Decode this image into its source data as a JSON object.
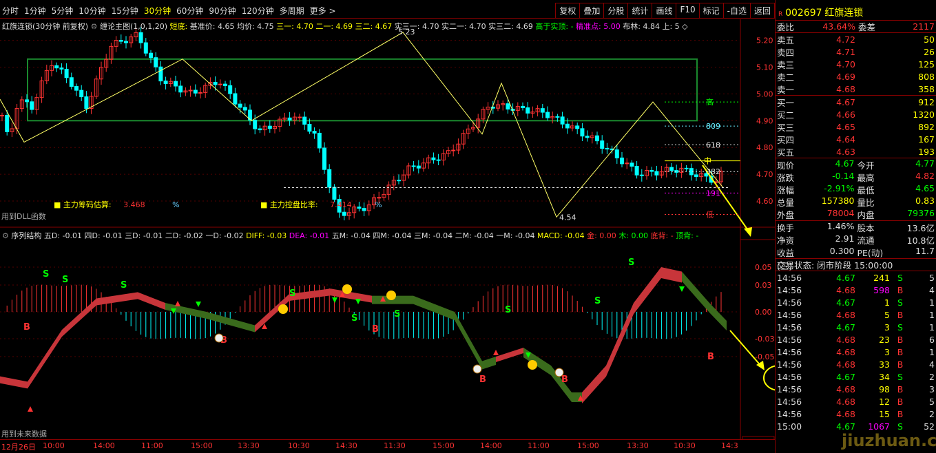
{
  "toolbar": {
    "periods": [
      "分时",
      "1分钟",
      "5分钟",
      "10分钟",
      "15分钟",
      "30分钟",
      "60分钟",
      "90分钟",
      "120分钟",
      "多周期",
      "更多 >"
    ],
    "active_period": "30分钟",
    "tools": [
      "复权",
      "叠加",
      "分股",
      "统计",
      "画线",
      "F10",
      "标记",
      "-自选",
      "返回"
    ]
  },
  "main_info": {
    "title": "红旗连锁(30分钟 前复权)",
    "indicator": "缠论主图(1,0,1,20)",
    "short": "短底:",
    "base": "基准价: 4.65",
    "avg": "均价: 4.75",
    "san1": "三一: 4.70",
    "er1": "二一: 4.69",
    "san2": "三二: 4.67",
    "shi1": "实三一: 4.70",
    "shi2": "实二一: 4.70",
    "shi3": "实三二: 4.69",
    "above": "高于实顶: -",
    "precise": "精准点: 5.00",
    "boll": "布林: 4.84 上: 5 ◇"
  },
  "labels": {
    "dll": "用到DLL函数",
    "future": "用到未来数据",
    "chip": "主力筹码估算:",
    "chip_val": "3.468",
    "pct": "%",
    "ctrl": "主力控盘比率:",
    "ctrl_val": "7.414",
    "high_peak": "5.23",
    "low_peak": "4.54",
    "gao": "高",
    "di": "低",
    "l809": "809",
    "l618": "618",
    "l382": "382",
    "l191": "191",
    "zhong": "中",
    "period_box": "30分钟"
  },
  "sub_info": {
    "title": "序列结构",
    "w5": "五D: -0.01",
    "w4": "四D: -0.01",
    "w3": "三D: -0.01",
    "w2": "二D: -0.02",
    "w1": "一D: -0.02",
    "diff": "DIFF: -0.03",
    "dea": "DEA: -0.01",
    "m5": "五M: -0.04",
    "m4": "四M: -0.04",
    "m3": "三M: -0.04",
    "m2": "二M: -0.04",
    "m1": "一M: -0.04",
    "macd": "MACD: -0.04",
    "jin": "金: 0.00",
    "mu": "木: 0.00",
    "dibei": "底背: -",
    "dingbei": "顶背: -"
  },
  "price_axis": [
    "5.20",
    "5.10",
    "5.00",
    "4.90",
    "4.80",
    "4.70",
    "4.60"
  ],
  "sub_axis": [
    "0.05",
    "0.03",
    "0.00",
    "-0.03",
    "-0.05"
  ],
  "time_axis": [
    "12月26日",
    "10:00",
    "14:00",
    "11:00",
    "15:00",
    "13:30",
    "10:30",
    "14:30",
    "11:30",
    "15:00",
    "14:00",
    "11:00",
    "15:00",
    "13:30",
    "10:30",
    "14:3"
  ],
  "stock": {
    "code": "002697",
    "name": "红旗连锁"
  },
  "order_book": {
    "ratio_label": "委比",
    "ratio": "43.64%",
    "diff_label": "委差",
    "diff": "2117",
    "asks": [
      {
        "l": "卖五",
        "p": "4.72",
        "v": "50"
      },
      {
        "l": "卖四",
        "p": "4.71",
        "v": "26"
      },
      {
        "l": "卖三",
        "p": "4.70",
        "v": "125"
      },
      {
        "l": "卖二",
        "p": "4.69",
        "v": "808"
      },
      {
        "l": "卖一",
        "p": "4.68",
        "v": "358"
      }
    ],
    "bids": [
      {
        "l": "买一",
        "p": "4.67",
        "v": "912"
      },
      {
        "l": "买二",
        "p": "4.66",
        "v": "1320"
      },
      {
        "l": "买三",
        "p": "4.65",
        "v": "892"
      },
      {
        "l": "买四",
        "p": "4.64",
        "v": "167"
      },
      {
        "l": "买五",
        "p": "4.63",
        "v": "193"
      }
    ]
  },
  "stats": [
    [
      {
        "t": "现价",
        "c": "w"
      },
      {
        "t": "4.67",
        "c": "g"
      },
      {
        "t": "今开",
        "c": "w"
      },
      {
        "t": "4.77",
        "c": "g"
      }
    ],
    [
      {
        "t": "涨跌",
        "c": "w"
      },
      {
        "t": "-0.14",
        "c": "g"
      },
      {
        "t": "最高",
        "c": "w"
      },
      {
        "t": "4.82",
        "c": "r"
      }
    ],
    [
      {
        "t": "涨幅",
        "c": "w"
      },
      {
        "t": "-2.91%",
        "c": "g"
      },
      {
        "t": "最低",
        "c": "w"
      },
      {
        "t": "4.65",
        "c": "g"
      }
    ],
    [
      {
        "t": "总量",
        "c": "w"
      },
      {
        "t": "157380",
        "c": "y"
      },
      {
        "t": "量比",
        "c": "w"
      },
      {
        "t": "0.83",
        "c": "y"
      }
    ],
    [
      {
        "t": "外盘",
        "c": "w"
      },
      {
        "t": "78004",
        "c": "r"
      },
      {
        "t": "内盘",
        "c": "w"
      },
      {
        "t": "79376",
        "c": "g"
      }
    ]
  ],
  "stats2": [
    [
      {
        "t": "换手",
        "c": "w"
      },
      {
        "t": "1.46%",
        "c": "w"
      },
      {
        "t": "股本",
        "c": "w"
      },
      {
        "t": "13.6亿",
        "c": "w"
      }
    ],
    [
      {
        "t": "净资",
        "c": "w"
      },
      {
        "t": "2.91",
        "c": "w"
      },
      {
        "t": "流通",
        "c": "w"
      },
      {
        "t": "10.8亿",
        "c": "w"
      }
    ],
    [
      {
        "t": "收益(三)",
        "c": "w"
      },
      {
        "t": "0.300",
        "c": "w"
      },
      {
        "t": "PE(动)",
        "c": "w"
      },
      {
        "t": "11.7",
        "c": "w"
      }
    ]
  ],
  "trade_status": "交易状态: 闭市阶段 15:00:00",
  "trades": [
    {
      "t": "14:56",
      "p": "4.67",
      "v": "241",
      "f": "S",
      "n": "5"
    },
    {
      "t": "14:56",
      "p": "4.68",
      "v": "598",
      "f": "B",
      "n": "4"
    },
    {
      "t": "14:56",
      "p": "4.67",
      "v": "1",
      "f": "S",
      "n": "1"
    },
    {
      "t": "14:56",
      "p": "4.68",
      "v": "5",
      "f": "B",
      "n": "1"
    },
    {
      "t": "14:56",
      "p": "4.67",
      "v": "3",
      "f": "S",
      "n": "1"
    },
    {
      "t": "14:56",
      "p": "4.68",
      "v": "23",
      "f": "B",
      "n": "6"
    },
    {
      "t": "14:56",
      "p": "4.68",
      "v": "3",
      "f": "B",
      "n": "1"
    },
    {
      "t": "14:56",
      "p": "4.68",
      "v": "33",
      "f": "B",
      "n": "4"
    },
    {
      "t": "14:56",
      "p": "4.67",
      "v": "34",
      "f": "S",
      "n": "2"
    },
    {
      "t": "14:56",
      "p": "4.68",
      "v": "98",
      "f": "B",
      "n": "3"
    },
    {
      "t": "14:56",
      "p": "4.68",
      "v": "12",
      "f": "B",
      "n": "5"
    },
    {
      "t": "14:56",
      "p": "4.68",
      "v": "15",
      "f": "B",
      "n": "2"
    },
    {
      "t": "15:00",
      "p": "4.67",
      "v": "1067",
      "f": "S",
      "n": "52"
    }
  ],
  "watermark": "jiuzhuan.com",
  "colors": {
    "up": "#ff3333",
    "down": "#00ffff",
    "red_band": "#c8353a",
    "green_band": "#3a6b1c",
    "box": "#1a8a2e",
    "zigzag": "#ffff66"
  }
}
